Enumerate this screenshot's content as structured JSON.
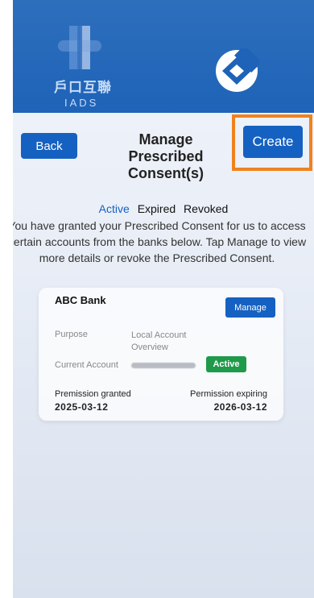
{
  "header": {
    "logo_cn": "戶口互聯",
    "logo_en": "IADS"
  },
  "toolbar": {
    "back_label": "Back",
    "title": "Manage Prescribed Consent(s)",
    "create_label": "Create"
  },
  "tabs": [
    {
      "label": "Active",
      "selected": true
    },
    {
      "label": "Expired",
      "selected": false
    },
    {
      "label": "Revoked",
      "selected": false
    }
  ],
  "description": "You have granted your Prescribed Consent for us to access certain accounts from the banks below. Tap Manage to view more details or revoke the Prescribed Consent.",
  "consent_card": {
    "bank_name": "ABC Bank",
    "manage_label": "Manage",
    "purpose_label": "Purpose",
    "purpose_value": "Local Account Overview",
    "account_label": "Current Account",
    "status": "Active",
    "granted_label": "Premission granted",
    "granted_date": "2025-03-12",
    "expiring_label": "Permission expiring",
    "expiring_date": "2026-03-12"
  },
  "colors": {
    "header_blue": "#1e63b8",
    "button_blue": "#1561c2",
    "highlight_orange": "#f0821e",
    "status_green": "#1f9a4a"
  }
}
